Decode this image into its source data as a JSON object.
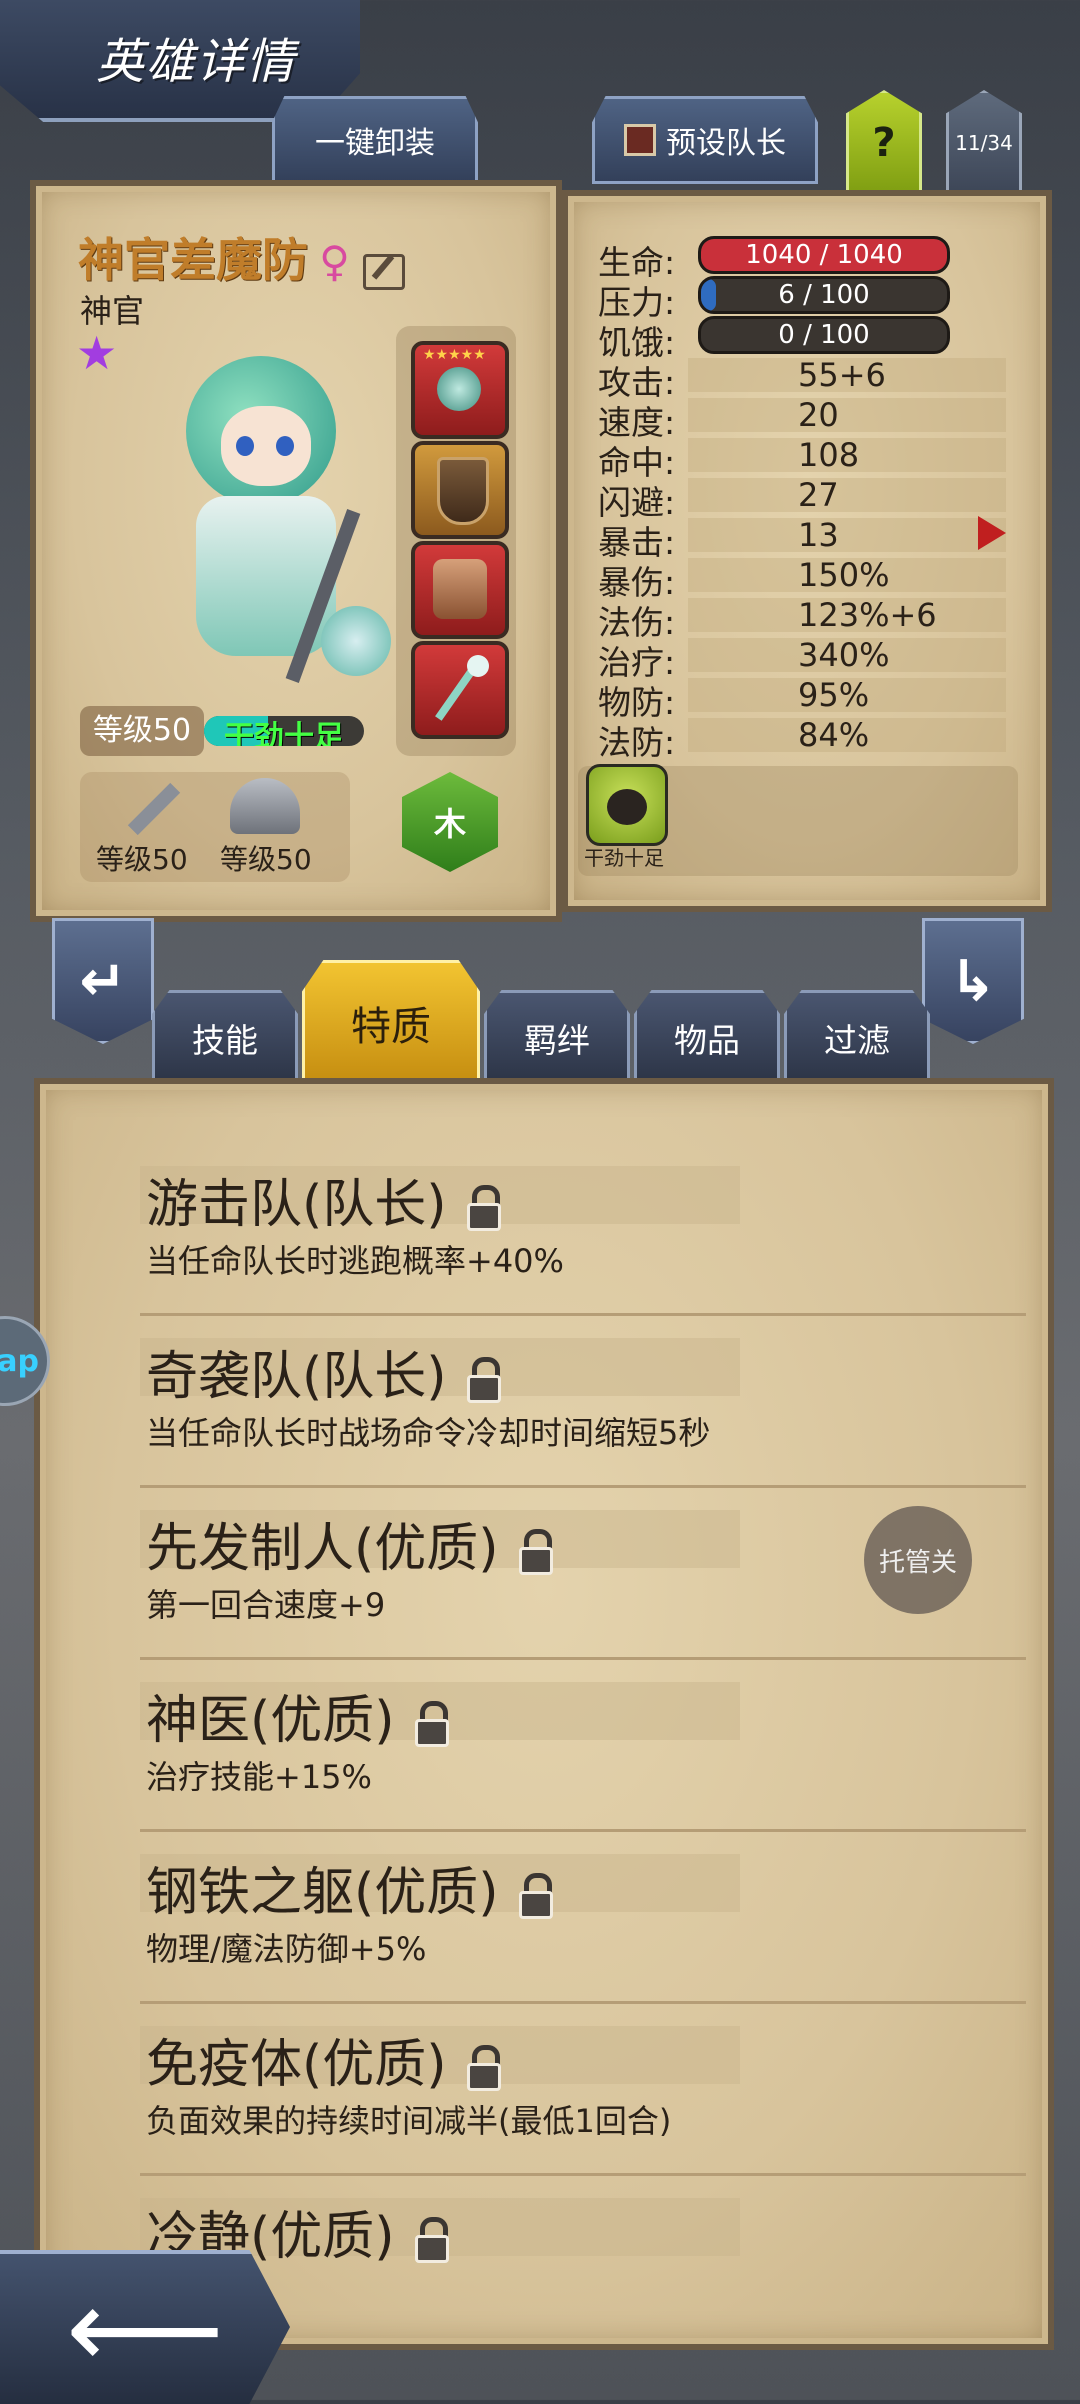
{
  "header": {
    "title": "英雄详情"
  },
  "top_tabs": {
    "unequip_all": "一键卸装",
    "preset_captain": "预设队长",
    "help": "?",
    "roster_count": "11/34"
  },
  "hero": {
    "name": "神官差魔防",
    "class": "神官",
    "level_label": "等级50",
    "status_label": "干劲十足",
    "weapon_level": "等级50",
    "armor_level": "等级50",
    "element": "木",
    "gender_icon": "female-icon",
    "star_color": "#a23de0"
  },
  "stats": {
    "rows": [
      {
        "label": "生命:",
        "value": "1040 / 1040",
        "type": "bar",
        "fraction": 1.0,
        "color": "#c9303a"
      },
      {
        "label": "压力:",
        "value": "6 / 100",
        "type": "bar",
        "fraction": 0.06,
        "color": "#2f6cc0"
      },
      {
        "label": "饥饿:",
        "value": "0 / 100",
        "type": "bar",
        "fraction": 0.0,
        "color": "#c9a040"
      },
      {
        "label": "攻击:",
        "value": "55+6"
      },
      {
        "label": "速度:",
        "value": "20"
      },
      {
        "label": "命中:",
        "value": "108"
      },
      {
        "label": "闪避:",
        "value": "27"
      },
      {
        "label": "暴击:",
        "value": "13"
      },
      {
        "label": "暴伤:",
        "value": "150%"
      },
      {
        "label": "法伤:",
        "value": "123%+6"
      },
      {
        "label": "治疗:",
        "value": "340%"
      },
      {
        "label": "物防:",
        "value": "95%"
      },
      {
        "label": "法防:",
        "value": "84%"
      }
    ],
    "buff_label": "干劲十足"
  },
  "bottom_tabs": [
    "技能",
    "特质",
    "羁绊",
    "物品",
    "过滤"
  ],
  "active_tab": "特质",
  "traits": [
    {
      "name": "游击队(队长)",
      "desc": "当任命队长时逃跑概率+40%"
    },
    {
      "name": "奇袭队(队长)",
      "desc": "当任命队长时战场命令冷却时间缩短5秒"
    },
    {
      "name": "先发制人(优质)",
      "desc": "第一回合速度+9"
    },
    {
      "name": "神医(优质)",
      "desc": "治疗技能+15%"
    },
    {
      "name": "钢铁之躯(优质)",
      "desc": "物理/魔法防御+5%"
    },
    {
      "name": "免疫体(优质)",
      "desc": "负面效果的持续时间减半(最低1回合)"
    },
    {
      "name": "冷静(优质)",
      "desc": ""
    }
  ],
  "float_button": "托管关",
  "side_bubble": "ap"
}
